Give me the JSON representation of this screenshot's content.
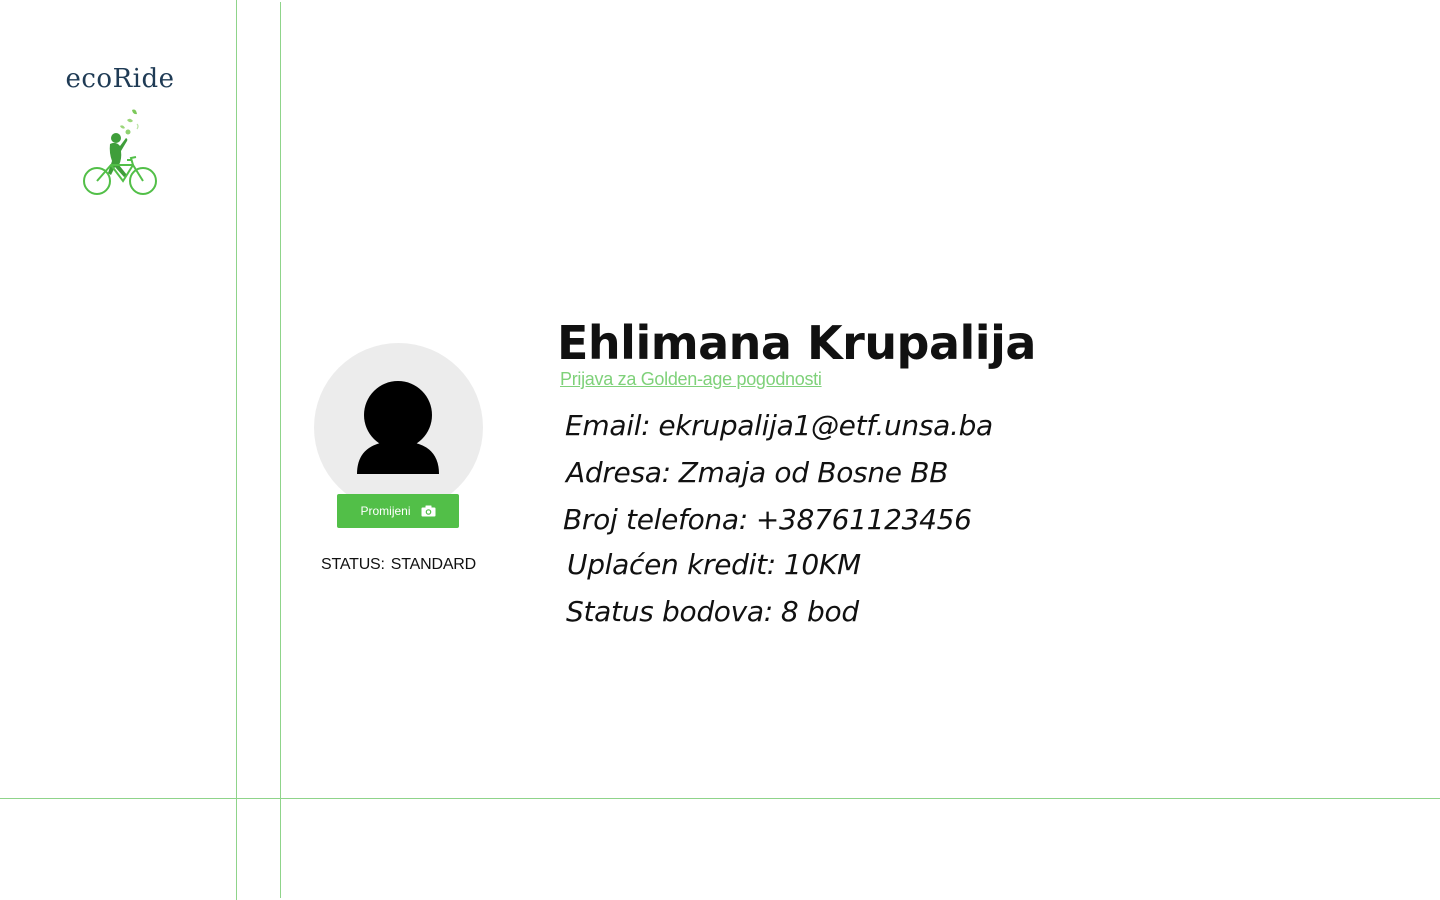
{
  "app": {
    "brand_name": "ecoRide",
    "brand_color": "#52bf48",
    "logo_icon": "cyclist-icon"
  },
  "profile": {
    "name": "Ehlimana Krupalija",
    "golden_age_link": "Prijava za Golden-age pogodnosti",
    "avatar_icon": "user-silhouette-icon",
    "change_button_label": "Promijeni",
    "change_button_icon": "camera-icon",
    "status_label": "STATUS:",
    "status_value": "STANDARD"
  },
  "details": {
    "email_label": "Email:",
    "email_value": "ekrupalija1@etf.unsa.ba",
    "address_label": "Adresa:",
    "address_value": "Zmaja od Bosne BB",
    "phone_label": "Broj telefona:",
    "phone_value": "+38761123456",
    "credit_label": "Uplaćen kredit:",
    "credit_value": "10KM",
    "points_label": "Status bodova:",
    "points_value": "8 bod"
  }
}
